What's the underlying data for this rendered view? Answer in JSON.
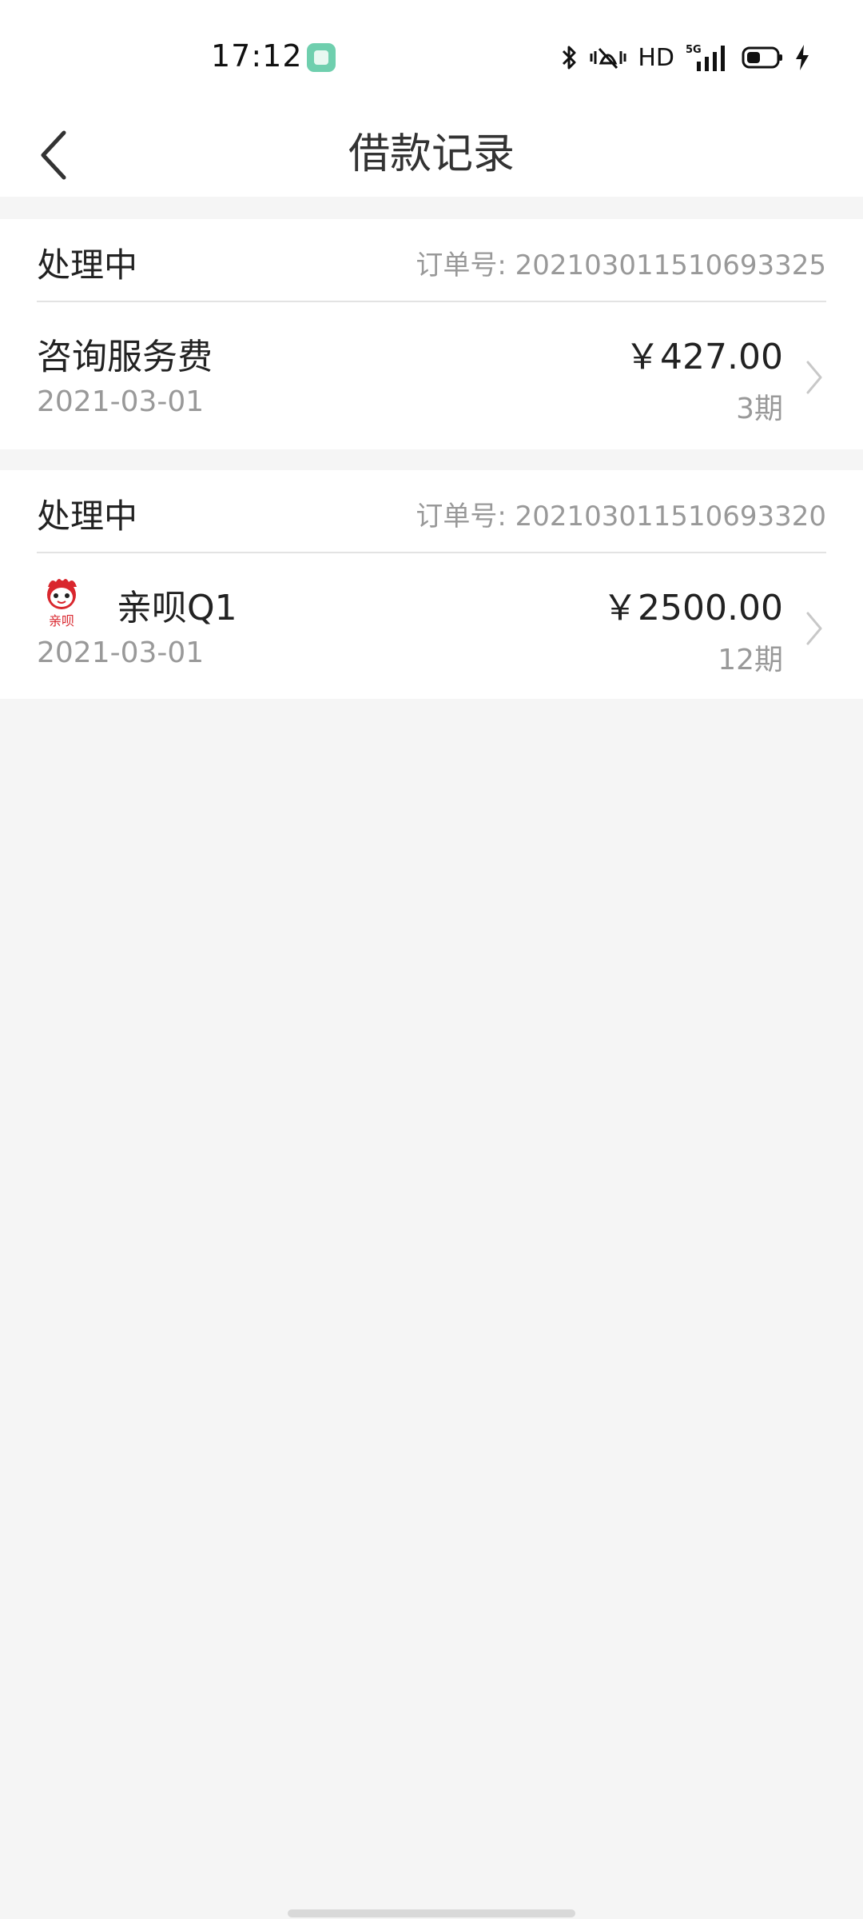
{
  "status_bar": {
    "time": "17:12",
    "network_label": "HD",
    "network_gen": "5G",
    "icons": [
      "bluetooth-icon",
      "vibrate-mute-icon",
      "signal-icon",
      "battery-icon",
      "charging-icon"
    ]
  },
  "header": {
    "title": "借款记录",
    "back_icon": "chevron-left-icon"
  },
  "records": [
    {
      "status": "处理中",
      "order_prefix": "订单号:",
      "order_number": "202103011510693325",
      "name": "咨询服务费",
      "date": "2021-03-01",
      "amount": "￥427.00",
      "term": "3期",
      "has_logo": false
    },
    {
      "status": "处理中",
      "order_prefix": "订单号:",
      "order_number": "202103011510693320",
      "name": "亲呗Q1",
      "date": "2021-03-01",
      "amount": "￥2500.00",
      "term": "12期",
      "has_logo": true,
      "logo_text": "亲呗"
    }
  ],
  "colors": {
    "page_background": "#f5f5f5",
    "card_background": "#ffffff",
    "primary_text": "#222222",
    "secondary_text": "#999999",
    "logo_red": "#d9272e"
  }
}
